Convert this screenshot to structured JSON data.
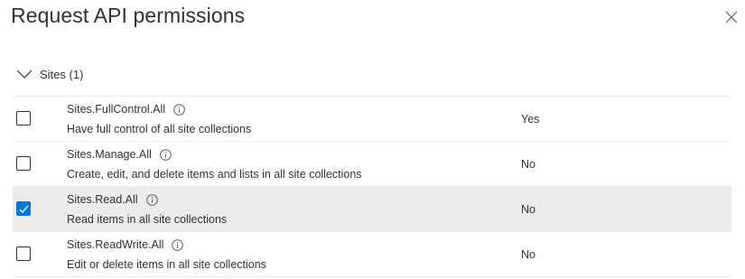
{
  "title": "Request API permissions",
  "group": {
    "label": "Sites (1)"
  },
  "permissions": [
    {
      "name": "Sites.FullControl.All",
      "description": "Have full control of all site collections",
      "admin_consent": "Yes",
      "checked": false
    },
    {
      "name": "Sites.Manage.All",
      "description": "Create, edit, and delete items and lists in all site collections",
      "admin_consent": "No",
      "checked": false
    },
    {
      "name": "Sites.Read.All",
      "description": "Read items in all site collections",
      "admin_consent": "No",
      "checked": true
    },
    {
      "name": "Sites.ReadWrite.All",
      "description": "Edit or delete items in all site collections",
      "admin_consent": "No",
      "checked": false
    }
  ],
  "icons": {
    "close": "close-icon",
    "chevron": "chevron-down-icon",
    "info": "info-icon",
    "check": "checkmark-icon"
  },
  "colors": {
    "accent": "#0078d4",
    "selected_row": "#edebe9",
    "text": "#323130"
  }
}
